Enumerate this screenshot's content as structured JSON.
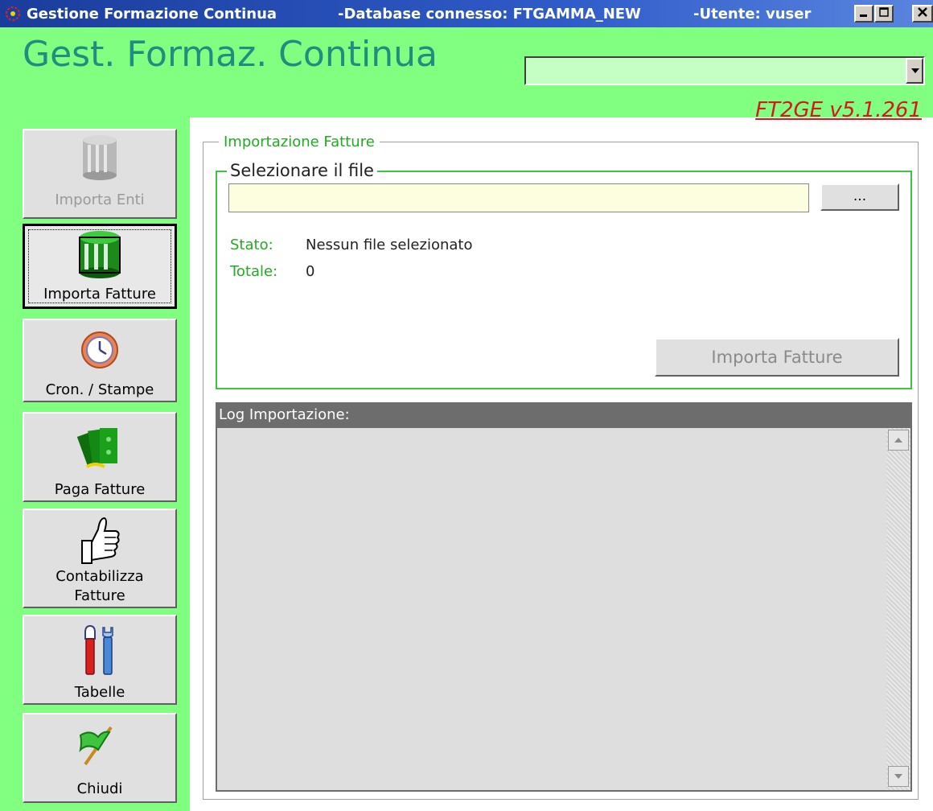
{
  "window": {
    "app_name": "Gestione Formazione Continua",
    "database": "-Database connesso: FTGAMMA_NEW",
    "user": "-Utente: vuser",
    "controls": {
      "minimize": "_",
      "maximize": "□",
      "close": "X"
    }
  },
  "header": {
    "title": "Gest. Formaz. Continua",
    "version": "FT2GE v5.1.261",
    "combo_value": ""
  },
  "sidebar": {
    "items": [
      {
        "label": "Importa Enti",
        "icon": "database-icon",
        "state": "disabled"
      },
      {
        "label": "Importa Fatture",
        "icon": "database-icon",
        "state": "active"
      },
      {
        "label": "Cron. / Stampe",
        "icon": "clock-icon",
        "state": "normal"
      },
      {
        "label": "Paga Fatture",
        "icon": "money-icon",
        "state": "normal"
      },
      {
        "label": "Contabilizza Fatture",
        "label_line1": "Contabilizza",
        "label_line2": "Fatture",
        "icon": "thumbs-up-icon",
        "state": "normal"
      },
      {
        "label": "Tabelle",
        "icon": "tools-icon",
        "state": "normal"
      },
      {
        "label": "Chiudi",
        "icon": "flag-icon",
        "state": "normal"
      }
    ]
  },
  "import_panel": {
    "group_title": "Importazione Fatture",
    "file_group_title": "Selezionare il file",
    "file_path": "",
    "browse_label": "...",
    "stato_label": "Stato:",
    "stato_value": "Nessun file selezionato",
    "totale_label": "Totale:",
    "totale_value": "0",
    "import_button": "Importa Fatture"
  },
  "log": {
    "title": "Log Importazione:",
    "content": ""
  },
  "colors": {
    "panel_green": "#80ff80",
    "title_teal": "#1f8e7e",
    "version_red": "#d21a1a",
    "accent_green": "#22aa22",
    "titlebar_blue": "#2f5bc8"
  }
}
